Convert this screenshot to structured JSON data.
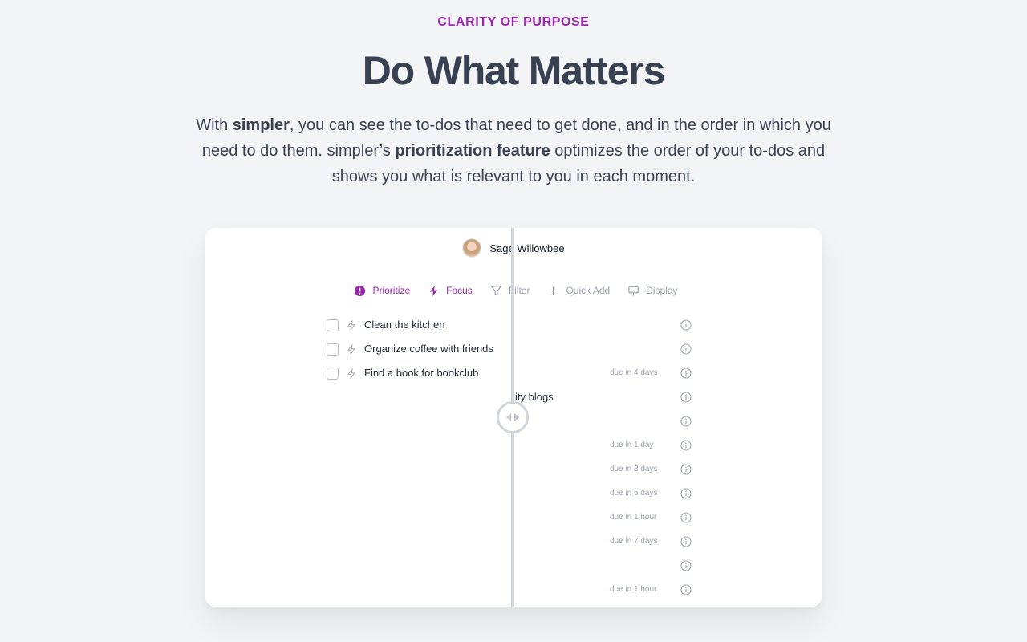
{
  "hero": {
    "eyebrow": "CLARITY OF PURPOSE",
    "title": "Do What Matters",
    "desc_1": "With ",
    "desc_bold_1": "simpler",
    "desc_2": ", you can see the to-dos that need to get done, and in the order in which you need to do them. simpler’s ",
    "desc_bold_2": "prioritization feature",
    "desc_3": " optimizes the order of your to-dos and shows you what is relevant to you in each moment."
  },
  "app": {
    "user_name": "Sage Willowbee",
    "toolbar": {
      "prioritize": "Prioritize",
      "focus": "Focus",
      "filter": "Filter",
      "quick_add": "Quick Add",
      "display": "Display"
    },
    "tasks": [
      {
        "title": "Clean the kitchen",
        "due": ""
      },
      {
        "title": "Organize coffee with friends",
        "due": ""
      },
      {
        "title": "Find a book for bookclub",
        "due": "due in 4 days"
      },
      {
        "title": "ity blogs",
        "due": ""
      },
      {
        "title": "",
        "due": ""
      },
      {
        "title": "",
        "due": "due in 1 day"
      },
      {
        "title": "",
        "due": "due in 8 days"
      },
      {
        "title": "",
        "due": "due in 5 days"
      },
      {
        "title": "",
        "due": "due in 1 hour"
      },
      {
        "title": "",
        "due": "due in 7 days"
      },
      {
        "title": "",
        "due": ""
      },
      {
        "title": "",
        "due": "due in 1 hour"
      }
    ],
    "accent_color": "#9c27b0"
  }
}
